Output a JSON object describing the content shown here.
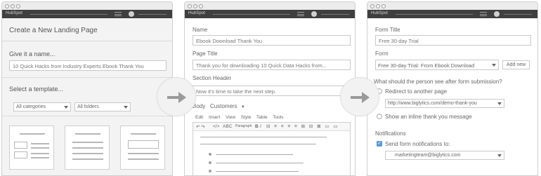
{
  "brand": {
    "logo": "HubSpot"
  },
  "step1": {
    "title": "Create a New Landing Page",
    "name_label": "Give it a name...",
    "name_value": "10 Quick Hacks from Industry Experts Ebook Thank You",
    "template_label": "Select a template...",
    "category_select": "All categories",
    "folder_select": "All folders"
  },
  "step2": {
    "name_label": "Name",
    "name_value": "Ebook Download Thank You",
    "page_title_label": "Page Title",
    "page_title_value": "Thank you for downloading 10 Quick Data Hacks from...",
    "section_header_label": "Section Header",
    "section_header_value": "Now it's time to take the next step.",
    "body_label": "Body",
    "body_select": "Customers",
    "menu": [
      "Edit",
      "Insert",
      "View",
      "Style",
      "Table",
      "Tools"
    ],
    "toolbar_text": "ABC",
    "toolbar_format": "Paragraph"
  },
  "step3": {
    "form_title_label": "Form Title",
    "form_title_value": "Free 30-day Trial",
    "form_label": "Form",
    "form_value": "Free 30-day Trial: From Ebook Download",
    "add_new": "Add new",
    "question": "What should the person see after form submission?",
    "redirect_label": "Redirect to another page",
    "redirect_url": "http://www.biglytics.com/demo-thank-you",
    "inline_label": "Show an inline thank you message",
    "notifications_label": "Notifications",
    "send_label": "Send form notifications to:",
    "email_value": "marketingteam@biglytics.com"
  },
  "colors": {
    "accent": "#5b9bd5",
    "navbar": "#3f3f3f"
  }
}
